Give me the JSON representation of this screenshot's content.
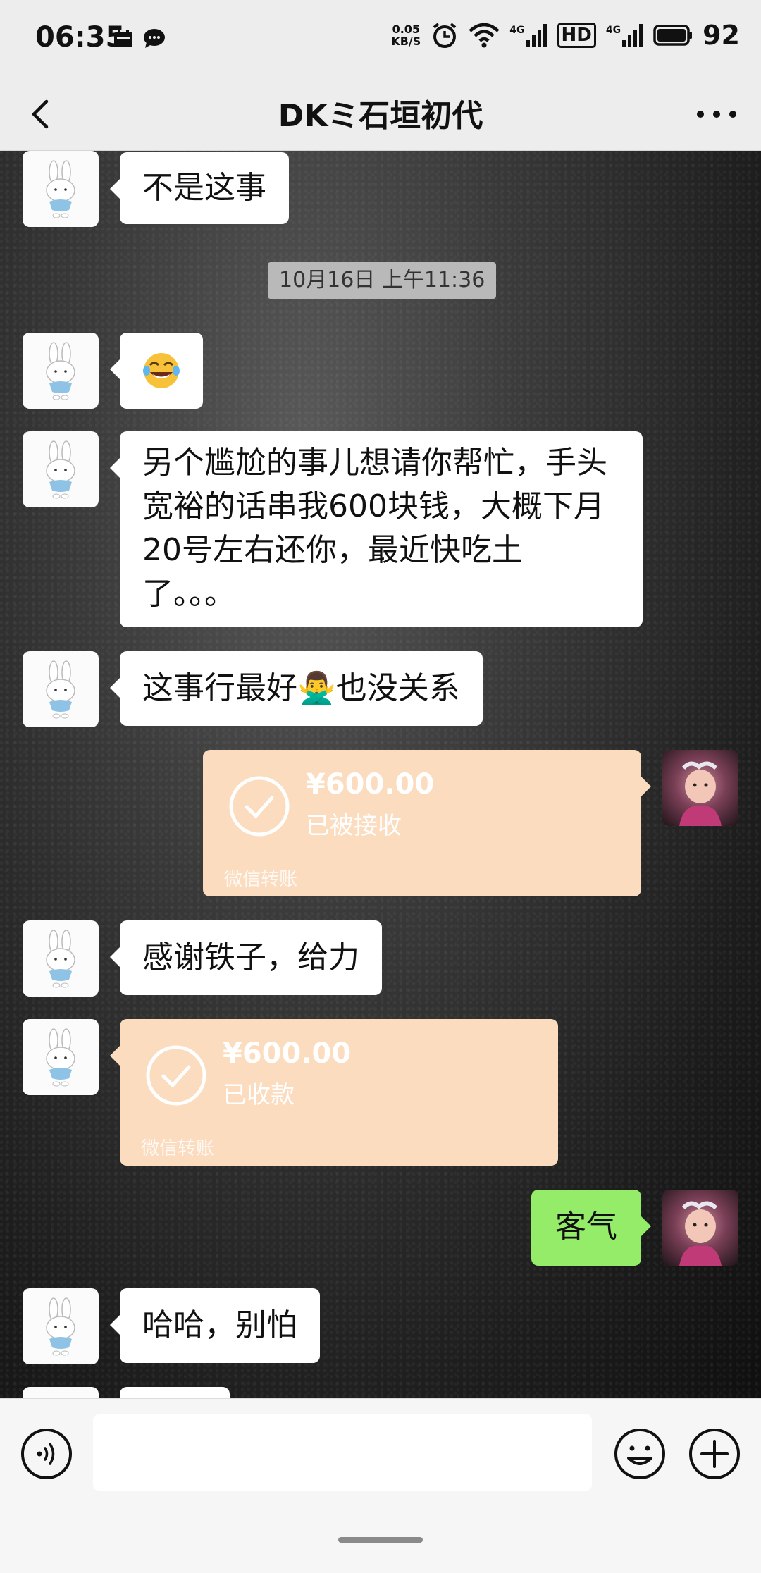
{
  "status_bar": {
    "time": "06:35",
    "net_speed_value": "0.05",
    "net_speed_unit": "KB/S",
    "signal_1": "4G",
    "hd_label": "HD",
    "signal_2": "4G",
    "battery": "92"
  },
  "header": {
    "title": "DKミ石垣初代",
    "back_icon": "chevron-left-icon",
    "more_icon": "more-dots-icon"
  },
  "chat": {
    "timestamp": "10月16日 上午11:36",
    "messages": [
      {
        "side": "left",
        "text": "不是这事"
      },
      {
        "side": "left",
        "text": "😂"
      },
      {
        "side": "left",
        "lines": [
          "另个尴尬的事儿想请你帮忙，手头",
          "宽裕的话串我600块钱，大概下月",
          "20号左右还你，最近快吃土",
          "了。。。"
        ]
      },
      {
        "side": "left",
        "text_before": "这事行最好",
        "emoji": "🙅‍♂️",
        "text_after": "也没关系"
      },
      {
        "side": "right",
        "type": "transfer",
        "amount": "¥600.00",
        "status": "已被接收",
        "footer": "微信转账"
      },
      {
        "side": "left",
        "text": "感谢铁子，给力"
      },
      {
        "side": "left",
        "type": "transfer",
        "amount": "¥600.00",
        "status": "已收款",
        "footer": "微信转账"
      },
      {
        "side": "right",
        "text": "客气"
      },
      {
        "side": "left",
        "text": "哈哈，别怕"
      }
    ]
  },
  "input_bar": {
    "voice_icon": "voice-icon",
    "emoji_icon": "emoji-icon",
    "plus_icon": "plus-icon"
  },
  "colors": {
    "bubble_self": "#95ec69",
    "bubble_other": "#ffffff",
    "transfer_bg": "#fbdcbf",
    "bar_bg": "#ededed"
  }
}
